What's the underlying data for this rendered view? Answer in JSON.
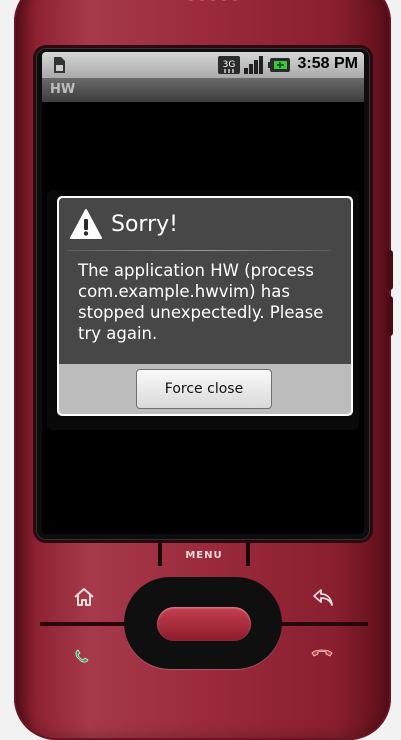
{
  "status_bar": {
    "time": "3:58 PM",
    "network_badge": "3G",
    "icons": [
      "sim-card-icon",
      "network-3g-icon",
      "signal-strength-icon",
      "battery-icon"
    ]
  },
  "app": {
    "title": "HW"
  },
  "dialog": {
    "icon": "warning-triangle-icon",
    "title": "Sorry!",
    "message": "The application HW (process com.example.hwvim) has stopped unexpectedly. Please try again.",
    "button_label": "Force close"
  },
  "device": {
    "menu_label": "MENU",
    "keys": [
      "home-icon",
      "back-icon",
      "call-icon",
      "end-call-icon"
    ]
  },
  "colors": {
    "phone_body": "#9b2b3c",
    "dialog_body": "#474747",
    "dialog_footer": "#bcbcbc",
    "call_green": "#2e9a55",
    "end_call_red": "#d23a3a"
  }
}
